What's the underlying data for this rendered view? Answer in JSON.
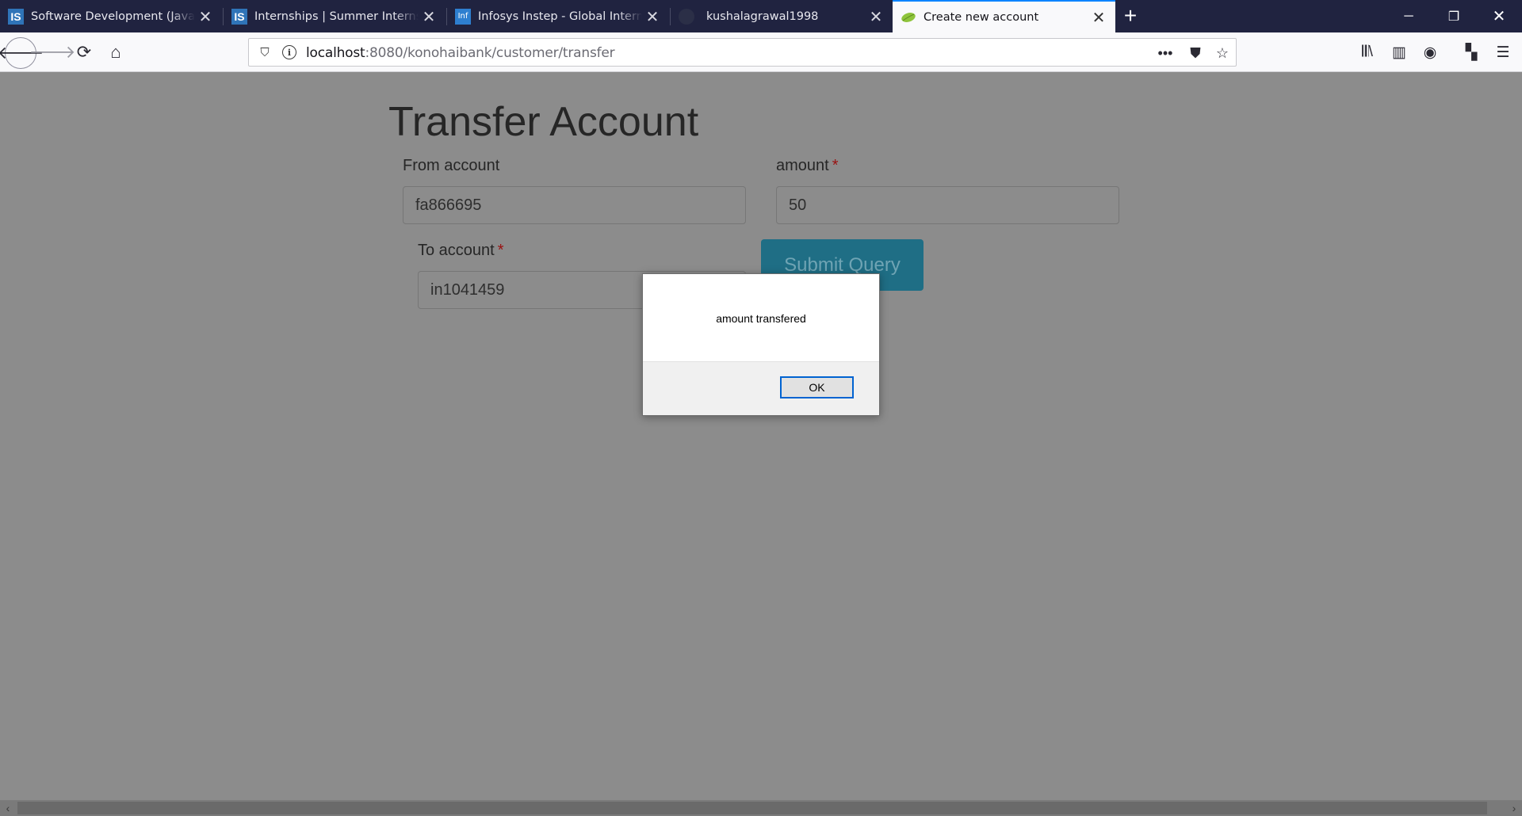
{
  "browser": {
    "tabs": [
      {
        "favicon": "IS",
        "title": "Software Development (Java) w",
        "active": false
      },
      {
        "favicon": "IS",
        "title": "Internships | Summer Internship",
        "active": false
      },
      {
        "favicon": "Inf",
        "title": "Infosys Instep - Global Internshi",
        "active": false
      },
      {
        "favicon": "",
        "title": "kushalagrawal1998",
        "active": false
      },
      {
        "favicon": "",
        "title": "Create new account",
        "active": true
      }
    ],
    "url_host": "localhost",
    "url_path": ":8080/konohaibank/customer/transfer"
  },
  "form": {
    "title": "Transfer Account",
    "from_label": "From account",
    "from_value": "fa866695",
    "amount_label": "amount",
    "amount_value": "50",
    "to_label": "To account",
    "to_value": "in1041459",
    "required_mark": "*",
    "submit_label": "Submit Query"
  },
  "alert": {
    "message": "amount transfered",
    "ok_label": "OK"
  }
}
